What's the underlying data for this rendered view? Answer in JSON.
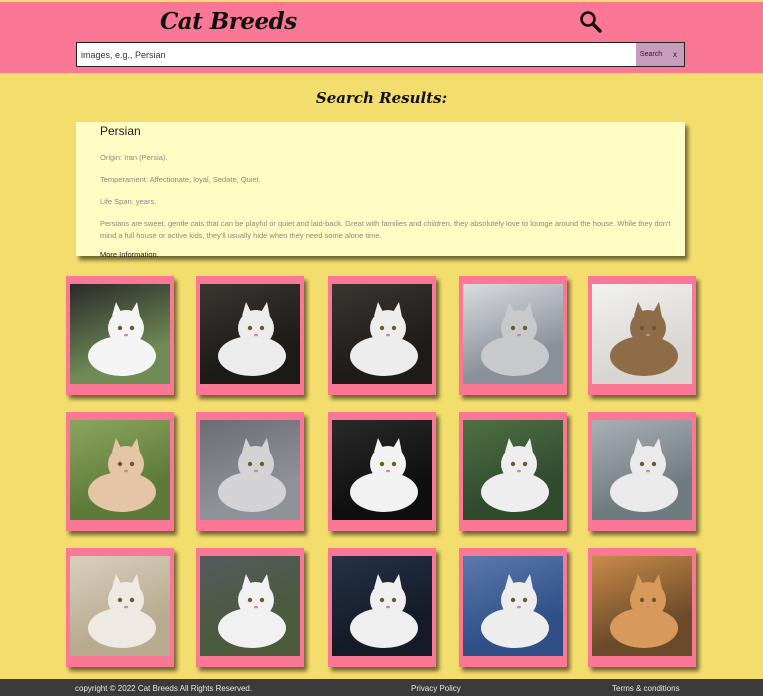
{
  "header": {
    "title": "Cat Breeds",
    "search_icon": "magnifier-icon",
    "search": {
      "placeholder": "images, e.g., Persian",
      "button_label": "Search",
      "clear_label": "x"
    }
  },
  "results": {
    "heading": "Search Results:",
    "breed": {
      "name": "Persian",
      "origin": "Origin: Iran (Persia).",
      "temperament": "Temperament: Affectionate, loyal, Sedate, Quiet.",
      "life_span": "Life Span: years.",
      "description": "Persians are sweet, gentle cats that can be playful or quiet and laid-back. Great with families and children, they absolutely love to lounge around the house. While they don't mind a full house or active kids, they'll usually hide when they need some alone time.",
      "more_info": "More Information."
    }
  },
  "gallery": {
    "photos": [
      {
        "subject": "white persian cat on animal print blanket",
        "bg": "#6f8a55",
        "cat": "#f4f4f4",
        "accent": "#2a2a2a"
      },
      {
        "subject": "white persian cat on dark background",
        "bg": "#1c1a17",
        "cat": "#ececec",
        "accent": "#3a3632"
      },
      {
        "subject": "white persian cat on dark background",
        "bg": "#1e1b18",
        "cat": "#ededed",
        "accent": "#3a3632"
      },
      {
        "subject": "grey persian cat sleeping by window",
        "bg": "#8a9099",
        "cat": "#c7c9cc",
        "accent": "#d9dce0"
      },
      {
        "subject": "brown tabby persian cat lying",
        "bg": "#d9d6d2",
        "cat": "#8d6c47",
        "accent": "#f2f2f2"
      },
      {
        "subject": "cream persian cat on grass",
        "bg": "#5d7a3a",
        "cat": "#e4c5a6",
        "accent": "#8aa55c"
      },
      {
        "subject": "grey and white persian cat sitting",
        "bg": "#8f9198",
        "cat": "#d3d3d6",
        "accent": "#6c6d73"
      },
      {
        "subject": "white persian cat lying on black",
        "bg": "#0f0f0f",
        "cat": "#f2f2f2",
        "accent": "#2a2a2a"
      },
      {
        "subject": "white persian cat on green blanket",
        "bg": "#2f4a2d",
        "cat": "#eeeeee",
        "accent": "#4f7044"
      },
      {
        "subject": "white persian cat close up",
        "bg": "#707b80",
        "cat": "#eaeaea",
        "accent": "#a7b0b5"
      },
      {
        "subject": "white persian kitten close up",
        "bg": "#b7aa8f",
        "cat": "#eeeae3",
        "accent": "#d9cfbd"
      },
      {
        "subject": "white persian cat on grass and slate",
        "bg": "#4a5a3a",
        "cat": "#f1f1f1",
        "accent": "#555a5e"
      },
      {
        "subject": "white persian cat sitting on navy",
        "bg": "#141a26",
        "cat": "#efefef",
        "accent": "#26324a"
      },
      {
        "subject": "white persian cat on blue sofa",
        "bg": "#2f4f86",
        "cat": "#ededed",
        "accent": "#5b79ad"
      },
      {
        "subject": "ginger persian cat face",
        "bg": "#6a4a2a",
        "cat": "#d79a5a",
        "accent": "#c98a4a"
      }
    ]
  },
  "footer": {
    "copyright": "copyright © 2022 Cat Breeds All Rights Reserved.",
    "privacy": "Privacy Policy",
    "terms": "Terms & conditions"
  },
  "colors": {
    "header_bg": "#fa7896",
    "page_bg": "#f3dd6c",
    "card_bg": "#fffdc4",
    "footer_bg": "#3b3b3b",
    "search_button_bg": "#c99bbd"
  }
}
